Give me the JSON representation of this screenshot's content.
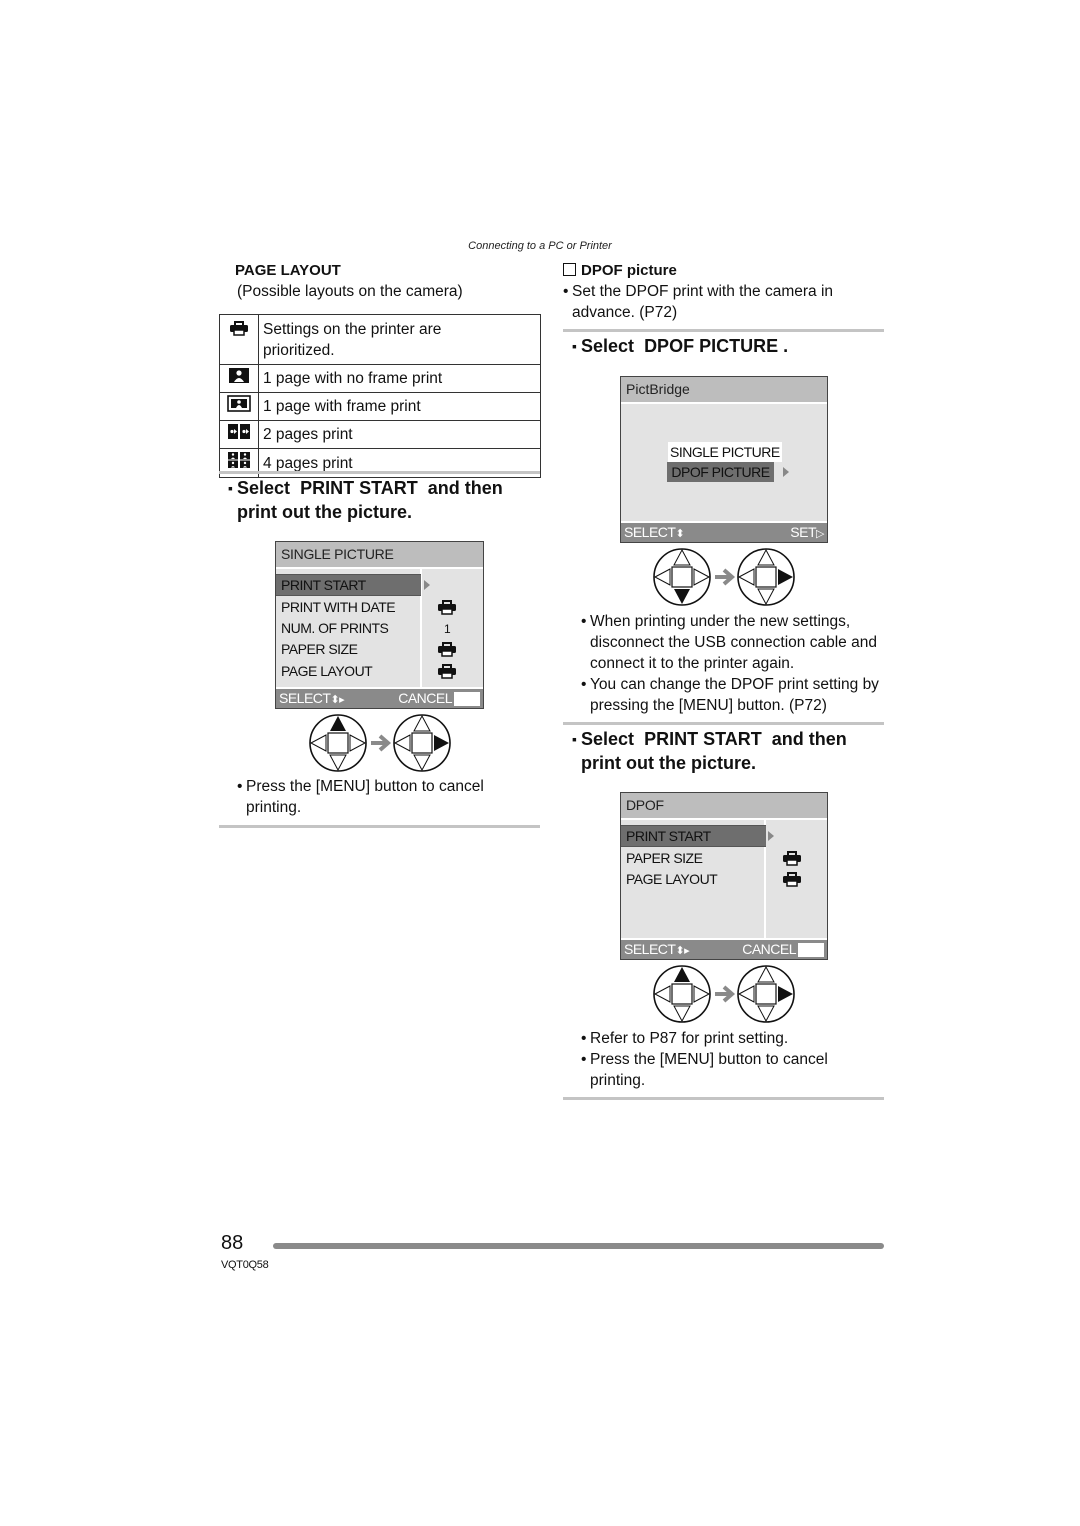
{
  "header": {
    "section_title": "Connecting to a PC or Printer"
  },
  "left": {
    "page_layout": {
      "heading": "PAGE LAYOUT",
      "subheading": "(Possible layouts on the camera)",
      "rows": [
        {
          "icon": "printer-icon",
          "text": "Settings on the printer are prioritized."
        },
        {
          "icon": "single-no-frame-icon",
          "text": "1 page with no frame print"
        },
        {
          "icon": "single-frame-icon",
          "text": "1 page with frame print"
        },
        {
          "icon": "two-pages-icon",
          "text": "2 pages print"
        },
        {
          "icon": "four-pages-icon",
          "text": "4 pages print"
        }
      ]
    },
    "step": {
      "prefix": "Select",
      "target": "PRINT START",
      "suffix": "and then",
      "line2": "print out the picture."
    },
    "screen": {
      "title": "SINGLE PICTURE",
      "items": [
        {
          "label": "PRINT START",
          "value": "",
          "selected": true
        },
        {
          "label": "PRINT WITH DATE",
          "value": "printer-icon"
        },
        {
          "label": "NUM. OF PRINTS",
          "value": "1"
        },
        {
          "label": "PAPER SIZE",
          "value": "printer-icon"
        },
        {
          "label": "PAGE LAYOUT",
          "value": "printer-icon"
        }
      ],
      "footer_left": "SELECT",
      "footer_right": "CANCEL"
    },
    "note": "Press the [MENU] button to cancel printing."
  },
  "right": {
    "dpof": {
      "heading": "DPOF picture",
      "note": "Set the DPOF print with the camera in advance. (P72)"
    },
    "step1": {
      "prefix": "Select",
      "target": "DPOF PICTURE",
      "suffix": "."
    },
    "screen1": {
      "title": "PictBridge",
      "items": [
        {
          "label": "SINGLE PICTURE",
          "selected": false
        },
        {
          "label": "DPOF PICTURE",
          "selected": true
        }
      ],
      "footer_left": "SELECT",
      "footer_right": "SET"
    },
    "notes1": [
      "When printing under the new settings, disconnect the USB connection cable and connect it to the printer again.",
      "You can change the DPOF print setting by pressing the [MENU] button. (P72)"
    ],
    "step2": {
      "prefix": "Select",
      "target": "PRINT START",
      "suffix": "and then",
      "line2": "print out the picture."
    },
    "screen2": {
      "title": "DPOF",
      "items": [
        {
          "label": "PRINT START",
          "value": "",
          "selected": true
        },
        {
          "label": "PAPER SIZE",
          "value": "printer-icon"
        },
        {
          "label": "PAGE LAYOUT",
          "value": "printer-icon"
        }
      ],
      "footer_left": "SELECT",
      "footer_right": "CANCEL"
    },
    "notes2": [
      "Refer to P87 for print setting.",
      "Press the [MENU] button to cancel printing."
    ]
  },
  "footer": {
    "page_number": "88",
    "model_code": "VQT0Q58"
  }
}
